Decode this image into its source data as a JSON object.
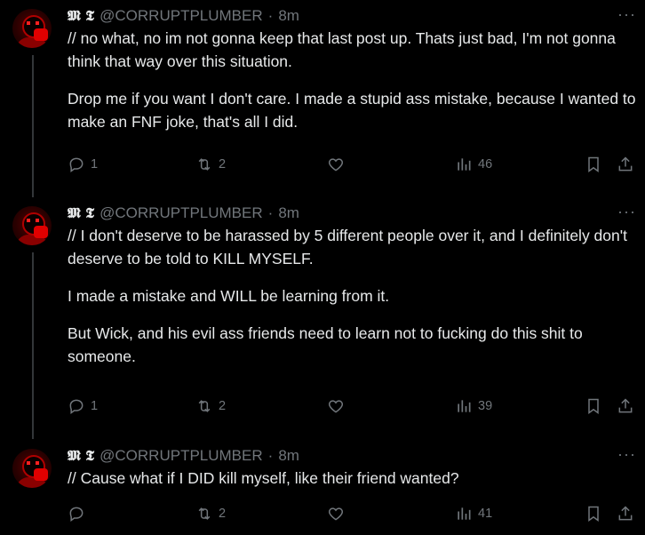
{
  "tweets": [
    {
      "display_name": "𝕸 𝕿",
      "handle": "@CORRUPTPLUMBER",
      "separator": "·",
      "time": "8m",
      "more": "···",
      "paragraphs": [
        "// no what, no im not gonna keep that last post up. Thats just bad, I'm not gonna think that way over this situation.",
        "Drop me if you want I don't care. I made a stupid ass mistake, because I wanted to make an FNF joke, that's all I did."
      ],
      "replies": "1",
      "reposts": "2",
      "views": "46"
    },
    {
      "display_name": "𝕸 𝕿",
      "handle": "@CORRUPTPLUMBER",
      "separator": "·",
      "time": "8m",
      "more": "···",
      "paragraphs": [
        "// I don't deserve to be harassed by 5 different people over it, and I definitely don't deserve to be told to KILL MYSELF.",
        "I made a mistake and WILL be learning from it.",
        "But Wick, and his evil ass friends need to learn not to fucking do this shit to someone."
      ],
      "replies": "1",
      "reposts": "2",
      "views": "39"
    },
    {
      "display_name": "𝕸 𝕿",
      "handle": "@CORRUPTPLUMBER",
      "separator": "·",
      "time": "8m",
      "more": "···",
      "paragraphs": [
        "// Cause what if I DID kill myself, like their friend wanted?"
      ],
      "replies": "",
      "reposts": "2",
      "views": "41"
    }
  ],
  "icons": {
    "reply": "reply-icon",
    "repost": "repost-icon",
    "like": "heart-icon",
    "views": "views-icon",
    "bookmark": "bookmark-icon",
    "share": "share-icon"
  },
  "colors": {
    "background": "#000000",
    "text": "#e7e9ea",
    "muted": "#71767b",
    "thread_line": "#333639"
  }
}
